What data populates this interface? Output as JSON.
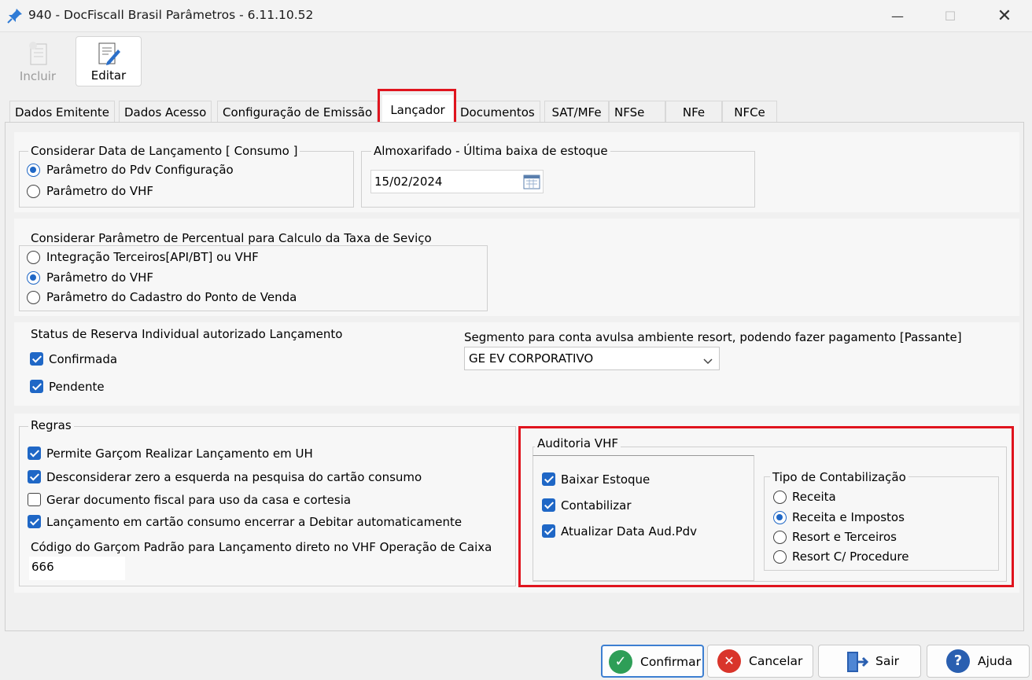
{
  "window": {
    "title": "940 - DocFiscall Brasil Parâmetros - 6.11.10.52"
  },
  "toolbar": {
    "incluir_label": "Incluir",
    "editar_label": "Editar"
  },
  "tabs": [
    {
      "label": "Dados Emitente"
    },
    {
      "label": "Dados Acesso"
    },
    {
      "label": "Configuração de Emissão"
    },
    {
      "label": "Lançador"
    },
    {
      "label": "Documentos"
    },
    {
      "label": "SAT/MFe"
    },
    {
      "label": "NFSe"
    },
    {
      "label": "NFe"
    },
    {
      "label": "NFCe"
    }
  ],
  "data_lancamento": {
    "legend": "Considerar Data de Lançamento [ Consumo ]",
    "options": [
      "Parâmetro do Pdv Configuração",
      "Parâmetro do VHF"
    ],
    "selected": "Parâmetro do Pdv Configuração"
  },
  "almoxarifado": {
    "legend": "Almoxarifado - Última baixa de estoque",
    "date_value": "15/02/2024"
  },
  "taxa_servico": {
    "legend": "Considerar Parâmetro de  Percentual para Calculo da Taxa de Seviço",
    "options": [
      "Integração Terceiros[API/BT] ou VHF",
      "Parâmetro do VHF",
      "Parâmetro do Cadastro do Ponto de Venda"
    ],
    "selected": "Parâmetro do VHF"
  },
  "status_reserva": {
    "label": "Status de Reserva Individual autorizado Lançamento",
    "confirmada": "Confirmada",
    "pendente": "Pendente"
  },
  "segmento": {
    "label": "Segmento para conta avulsa ambiente resort,  podendo fazer pagamento [Passante]",
    "selected": "GE EV CORPORATIVO"
  },
  "regras": {
    "legend": "Regras",
    "items": [
      {
        "label": "Permite Garçom Realizar Lançamento em UH",
        "checked": true
      },
      {
        "label": "Desconsiderar  zero a esquerda na pesquisa do cartão consumo",
        "checked": true
      },
      {
        "label": "Gerar documento fiscal para uso da casa e cortesia",
        "checked": false
      },
      {
        "label": "Lançamento em cartão consumo encerrar a Debitar automaticamente",
        "checked": true
      }
    ],
    "codigo_label": "Código do Garçom Padrão para Lançamento direto no VHF Operação de Caixa",
    "codigo_value": "666"
  },
  "auditoria": {
    "legend": "Auditoria VHF",
    "checks": [
      {
        "label": "Baixar Estoque",
        "checked": true
      },
      {
        "label": "Contabilizar",
        "checked": true
      },
      {
        "label": "Atualizar Data Aud.Pdv",
        "checked": true
      }
    ],
    "tipo_legend": "Tipo de Contabilização",
    "tipo_options": [
      "Receita",
      "Receita e Impostos",
      "Resort e Terceiros",
      "Resort C/ Procedure"
    ],
    "tipo_selected": "Receita e Impostos"
  },
  "footer": {
    "confirmar": "Confirmar",
    "cancelar": "Cancelar",
    "sair": "Sair",
    "ajuda": "Ajuda"
  },
  "colors": {
    "accent": "#1f67c6",
    "highlight_red": "#e0141e",
    "confirm_green": "#2e9e57",
    "cancel_red": "#d9352b",
    "help_blue": "#2a5fb0"
  }
}
